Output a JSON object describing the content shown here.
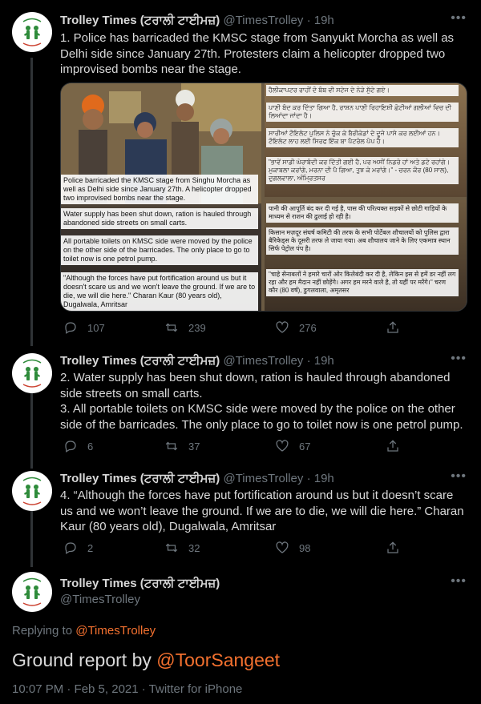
{
  "tweets": [
    {
      "name": "Trolley Times (ਟਰਾਲੀ ਟਾਈਮਜ਼)",
      "handle": "@TimesTrolley",
      "dot": "·",
      "time": "19h",
      "text": "1. Police has barricaded the KMSC stage from Sanyukt Morcha as well as Delhi side since January 27th. Protesters claim a helicopter dropped two improvised bombs near the stage.",
      "replies": "107",
      "retweets": "239",
      "likes": "276"
    },
    {
      "name": "Trolley Times (ਟਰਾਲੀ ਟਾਈਮਜ਼)",
      "handle": "@TimesTrolley",
      "dot": "·",
      "time": "19h",
      "text": "2. Water supply has been shut down, ration is hauled through abandoned side streets on small carts.\n3. All portable toilets on KMSC side were moved by the police on the other side of the barricades. The only place to go to toilet now is one petrol pump.",
      "replies": "6",
      "retweets": "37",
      "likes": "67"
    },
    {
      "name": "Trolley Times (ਟਰਾਲੀ ਟਾਈਮਜ਼)",
      "handle": "@TimesTrolley",
      "dot": "·",
      "time": "19h",
      "text": "4. “Although the forces have put fortification around us but it doesn’t scare us and we won’t leave the ground. If we are to die, we will die here.” Charan Kaur (80 years old), Dugalwala, Amritsar",
      "replies": "2",
      "retweets": "32",
      "likes": "98"
    }
  ],
  "main_tweet": {
    "name": "Trolley Times (ਟਰਾਲੀ ਟਾਈਮਜ਼)",
    "handle": "@TimesTrolley",
    "replying_prefix": "Replying to ",
    "replying_to": "@TimesTrolley",
    "text_prefix": "Ground report by ",
    "text_mention": "@ToorSangeet",
    "timestamp": "10:07 PM · Feb 5, 2021 · Twitter for iPhone"
  },
  "media": {
    "left_captions": [
      "Police barricaded the KMSC stage from Singhu Morcha as well as Delhi side since January 27th. A helicopter dropped two improvised bombs near the stage.",
      "Water supply has been shut down, ration is hauled through abandoned side streets on small carts.",
      "All portable toilets on KMSC side were moved by the police on the other side of the barricades. The only place to go to toilet now is one petrol pump.",
      "\"Although the forces have put fortification around us but it doesn't scare us and we won't leave the ground. If we are to die, we will die here.\" Charan Kaur (80 years old), Dugalwala, Amritsar"
    ],
    "punjabi_captions": [
      "ਹੈਲੀਕਾਪਟਰ ਰਾਹੀਂ ਦੋ ਬੰਬ ਵੀ ਸਟੇਜ ਦੇ ਨੇੜੇ ਸੁੱਟੇ ਗਏ।",
      "ਪਾਣੀ ਬੰਦ ਕਰ ਦਿੱਤਾ ਗਿਆ ਹੈ, ਰਾਸ਼ਨ ਪਾਣੀ ਰਿਹਾਇਸ਼ੀ ਛੋਟੀਆਂ ਗਲੀਆਂ ਵਿਚ ਦੀ ਲਿਆਂਦਾ ਜਾਂਦਾ ਹੈ।",
      "ਸਾਰੀਆਂ ਟੌਇਲੇਟ ਪੁਲਿਸ ਨੇ ਚੁੱਕ ਕੇ ਬੈਰੀਕੇਡਾਂ ਦੇ ਦੂਜੇ ਪਾਸੇ ਕਰ ਲਈਆਂ ਹਨ। ਟੌਇਲੇਟ ਲਾਹ ਲਈ ਸਿਰਫ ਇੱਕ ਬਾ ਪੈਟਰੋਲ ਪੰਪ ਹੈ।",
      "\"ਭਾਵੇਂ ਸਾਡੀ ਘੇਰਾਬੰਦੀ ਕਰ ਦਿੱਤੀ ਗਈ ਹੈ, ਪਰ ਅਸੀਂ ਨਿਡਰੋ ਹਾਂ ਅਤੇ ਡਟੇ ਰਹਾਂਗੇ। ਮੁਕਾਬਲਾ ਕਰਾਂਗੇ, ਮਰਨਾ ਦੀ ਪੈ ਗਿਆ, ਤੁਝ ਕੇ ਮਰਾਂਗੇ।\" - ਚਰਨ ਕੌਰ (80 ਸਾਲ), ਦੁਗਲਵਾਲਾ, ਅੰਮ੍ਰਿਤਸਰ"
    ],
    "hindi_captions": [
      "पानी की आपूर्ति बंद कर दी गई है, पास की परित्यक्त सड़कों से छोटी गाड़ियों के माध्यम से राशन की ढुलाई हो रही है।",
      "किसान मज़दूर संघर्ष कमिटी की तरफ के सभी पोर्टेबल शौचालयों को पुलिस द्वारा बैरिकेड्स के दूसरी तरफ ले जाया गया। अब शौचालय जाने के लिए एकमात्र स्थान सिर्फ पेट्रोल पंप है।",
      "\"चाहे सेनाबलों ने हमारे चारों ओर किलेबंदी कर दी है, लेकिन इस से हमें डर नहीं लग रहा और हम मैदान नहीं छोड़ेंगे। अगर हम मरने वाले है, तो यहीं पर मरेंगे।\" चरण कौर (80 वर्ष), डुगलवाला, अमृतसर"
    ]
  },
  "icons": {
    "more": "more-dots-icon",
    "reply": "reply-icon",
    "retweet": "retweet-icon",
    "like": "heart-icon",
    "share": "share-icon"
  },
  "colors": {
    "background": "#000000",
    "text": "#d9d9d9",
    "muted": "#6e767d",
    "accent": "#f4712f",
    "divider": "#2f3336"
  }
}
